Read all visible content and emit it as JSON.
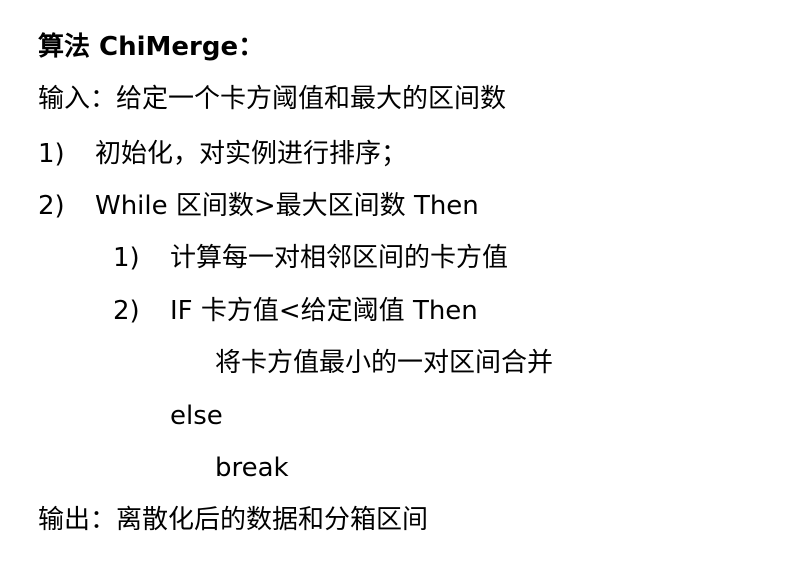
{
  "algorithm": {
    "title": "算法 ChiMerge：",
    "input": "输入：给定一个卡方阈值和最大的区间数",
    "steps": [
      {
        "number": "1)",
        "text": "初始化，对实例进行排序；"
      },
      {
        "number": "2)",
        "text": "While 区间数>最大区间数 Then"
      }
    ],
    "substeps": [
      {
        "number": "1)",
        "text": "计算每一对相邻区间的卡方值"
      },
      {
        "number": "2)",
        "text": "IF 卡方值<给定阈值 Then"
      }
    ],
    "merge_action": "将卡方值最小的一对区间合并",
    "else_keyword": "else",
    "break_keyword": "break",
    "output": "输出：离散化后的数据和分箱区间"
  }
}
